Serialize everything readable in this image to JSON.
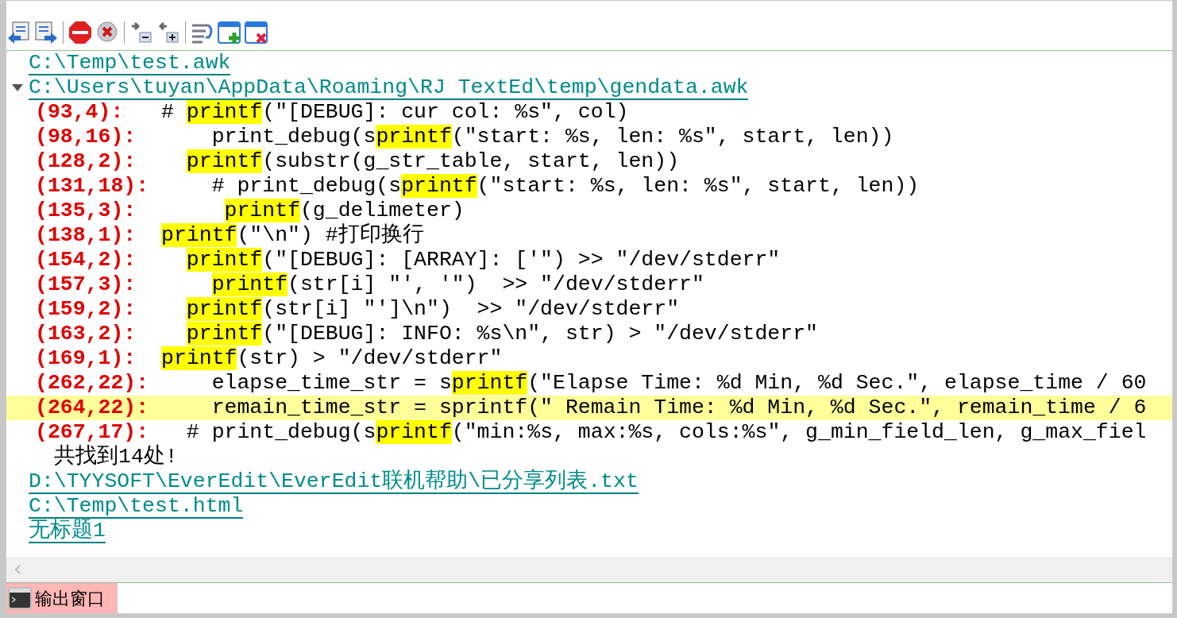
{
  "output": {
    "files": [
      {
        "path": "C:\\Temp\\test.awk"
      },
      {
        "path": "C:\\Users\\tuyan\\AppData\\Roaming\\RJ TextEd\\temp\\gendata.awk",
        "expanded": true,
        "results": [
          {
            "location": "(93,4):   ",
            "selected": false,
            "segments": [
              {
                "text": "# ",
                "highlight": false
              },
              {
                "text": "printf",
                "highlight": true
              },
              {
                "text": "(\"[DEBUG]: cur col: %s\", col)",
                "highlight": false
              }
            ]
          },
          {
            "location": "(98,16):      ",
            "selected": false,
            "segments": [
              {
                "text": "print_debug(s",
                "highlight": false
              },
              {
                "text": "printf",
                "highlight": true
              },
              {
                "text": "(\"start: %s, len: %s\", start, len))",
                "highlight": false
              }
            ]
          },
          {
            "location": "(128,2):    ",
            "selected": false,
            "segments": [
              {
                "text": "printf",
                "highlight": true
              },
              {
                "text": "(substr(g_str_table, start, len))",
                "highlight": false
              }
            ]
          },
          {
            "location": "(131,18):     ",
            "selected": false,
            "segments": [
              {
                "text": "# print_debug(s",
                "highlight": false
              },
              {
                "text": "printf",
                "highlight": true
              },
              {
                "text": "(\"start: %s, len: %s\", start, len))",
                "highlight": false
              }
            ]
          },
          {
            "location": "(135,3):       ",
            "selected": false,
            "segments": [
              {
                "text": "printf",
                "highlight": true
              },
              {
                "text": "(g_delimeter)",
                "highlight": false
              }
            ]
          },
          {
            "location": "(138,1):  ",
            "selected": false,
            "segments": [
              {
                "text": "printf",
                "highlight": true
              },
              {
                "text": "(\"\\n\") #打印换行",
                "highlight": false
              }
            ]
          },
          {
            "location": "(154,2):    ",
            "selected": false,
            "segments": [
              {
                "text": "printf",
                "highlight": true
              },
              {
                "text": "(\"[DEBUG]: [ARRAY]: ['\") >> \"/dev/stderr\"",
                "highlight": false
              }
            ]
          },
          {
            "location": "(157,3):      ",
            "selected": false,
            "segments": [
              {
                "text": "printf",
                "highlight": true
              },
              {
                "text": "(str[i] \"', '\")  >> \"/dev/stderr\"",
                "highlight": false
              }
            ]
          },
          {
            "location": "(159,2):    ",
            "selected": false,
            "segments": [
              {
                "text": "printf",
                "highlight": true
              },
              {
                "text": "(str[i] \"']\\n\")  >> \"/dev/stderr\"",
                "highlight": false
              }
            ]
          },
          {
            "location": "(163,2):    ",
            "selected": false,
            "segments": [
              {
                "text": "printf",
                "highlight": true
              },
              {
                "text": "(\"[DEBUG]: INFO: %s\\n\", str) > \"/dev/stderr\"",
                "highlight": false
              }
            ]
          },
          {
            "location": "(169,1):  ",
            "selected": false,
            "segments": [
              {
                "text": "printf",
                "highlight": true
              },
              {
                "text": "(str) > \"/dev/stderr\"",
                "highlight": false
              }
            ]
          },
          {
            "location": "(262,22):     ",
            "selected": false,
            "segments": [
              {
                "text": "elapse_time_str = s",
                "highlight": false
              },
              {
                "text": "printf",
                "highlight": true
              },
              {
                "text": "(\"Elapse Time: %d Min, %d Sec.\", elapse_time / 60",
                "highlight": false
              }
            ]
          },
          {
            "location": "(264,22):     ",
            "selected": true,
            "segments": [
              {
                "text": "remain_time_str = sprintf(\" Remain Time: %d Min, %d Sec.\", remain_time / 6",
                "highlight": false
              }
            ]
          },
          {
            "location": "(267,17):   ",
            "selected": false,
            "segments": [
              {
                "text": "# print_debug(s",
                "highlight": false
              },
              {
                "text": "printf",
                "highlight": true
              },
              {
                "text": "(\"min:%s, max:%s, cols:%s\", g_min_field_len, g_max_fiel",
                "highlight": false
              }
            ]
          }
        ],
        "summary": "共找到14处!"
      },
      {
        "path": "D:\\TYYSOFT\\EverEdit\\EverEdit联机帮助\\已分享列表.txt"
      },
      {
        "path": "C:\\Temp\\test.html"
      },
      {
        "path": "无标题1"
      }
    ]
  },
  "tabs": [
    {
      "label": "输出窗口",
      "selected": true
    }
  ]
}
